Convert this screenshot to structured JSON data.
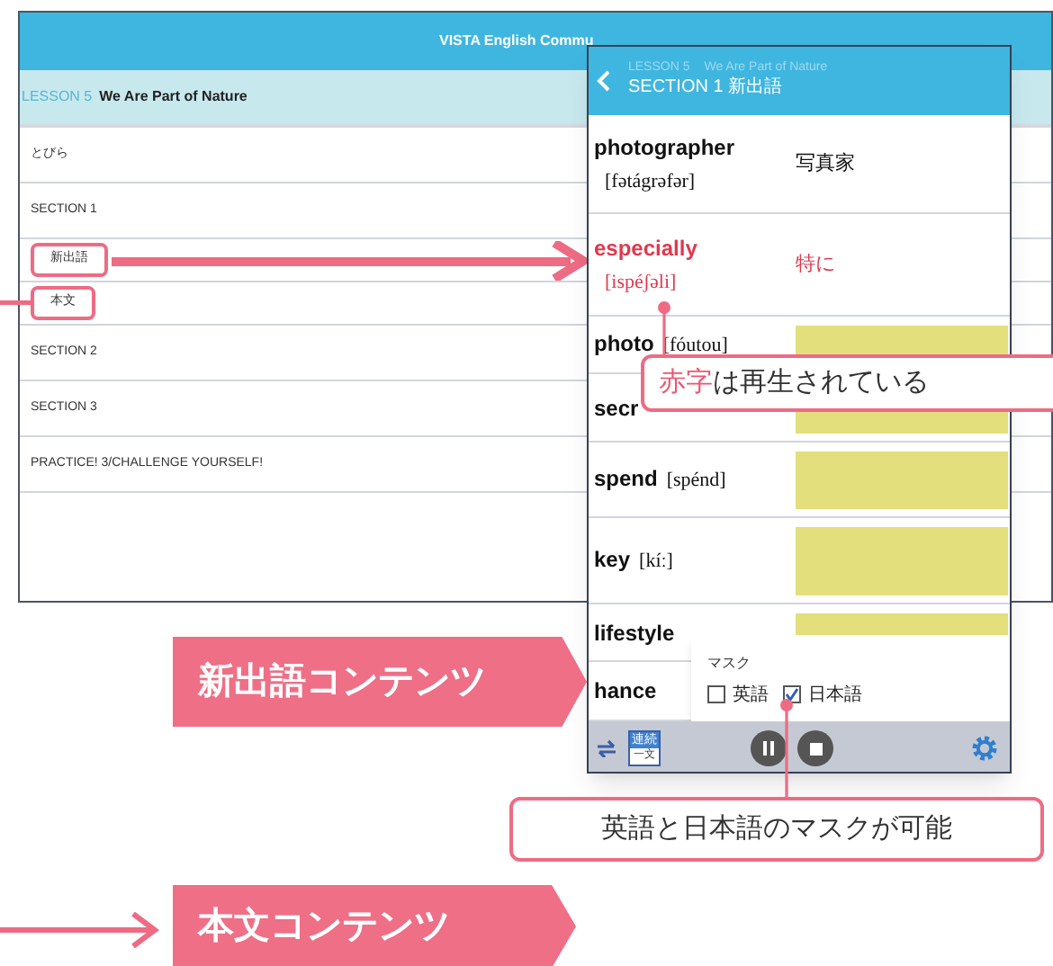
{
  "lesson_list_screen": {
    "title": "VISTA English Commu",
    "lesson": {
      "number": "LESSON 5",
      "title": "We Are Part of Nature"
    },
    "rows": [
      {
        "label": "とびら",
        "kind": "plain"
      },
      {
        "label": "SECTION 1",
        "kind": "section"
      },
      {
        "label": "新出語",
        "kind": "highlighted"
      },
      {
        "label": "本文",
        "kind": "highlighted"
      },
      {
        "label": "SECTION 2",
        "kind": "section"
      },
      {
        "label": "SECTION 3",
        "kind": "section"
      },
      {
        "label": "PRACTICE! 3/CHALLENGE YOURSELF!",
        "kind": "section"
      }
    ]
  },
  "word_screen": {
    "header": {
      "lesson": "LESSON 5",
      "lesson_title": "We Are Part of Nature",
      "section": "SECTION 1 新出語"
    },
    "words": [
      {
        "word": "photographer",
        "pronunciation": "[fətágrəfər]",
        "meaning": "写真家",
        "kind": "stacked",
        "playing": false,
        "masked": false
      },
      {
        "word": "especially",
        "pronunciation": "[ispéʃəli]",
        "meaning": "特に",
        "kind": "stacked",
        "playing": true,
        "masked": false
      },
      {
        "word": "photo",
        "pronunciation": "[fóutou]",
        "kind": "inline",
        "playing": false,
        "masked": true
      },
      {
        "word": "secr",
        "kind": "inline",
        "playing": false,
        "masked": true
      },
      {
        "word": "spend",
        "pronunciation": "[spénd]",
        "kind": "inline",
        "playing": false,
        "masked": true
      },
      {
        "word": "key",
        "pronunciation": "[kíː]",
        "kind": "inline",
        "playing": false,
        "masked": true
      },
      {
        "word": "lifestyle",
        "kind": "inline",
        "playing": false,
        "masked": true
      },
      {
        "word": "hance",
        "kind": "inline",
        "playing": false
      }
    ],
    "mask_panel": {
      "title": "マスク",
      "options": [
        {
          "label": "英語",
          "checked": false
        },
        {
          "label": "日本語",
          "checked": true
        }
      ]
    },
    "toolbar": {
      "mode_top": "連続",
      "mode_bottom": "一文"
    }
  },
  "callouts": [
    {
      "highlight": "赤字",
      "text": "は再生されている"
    },
    {
      "text": "英語と日本語のマスクが可能"
    }
  ],
  "banners": [
    {
      "text": "新出語コンテンツ"
    },
    {
      "text": "本文コンテンツ"
    }
  ]
}
